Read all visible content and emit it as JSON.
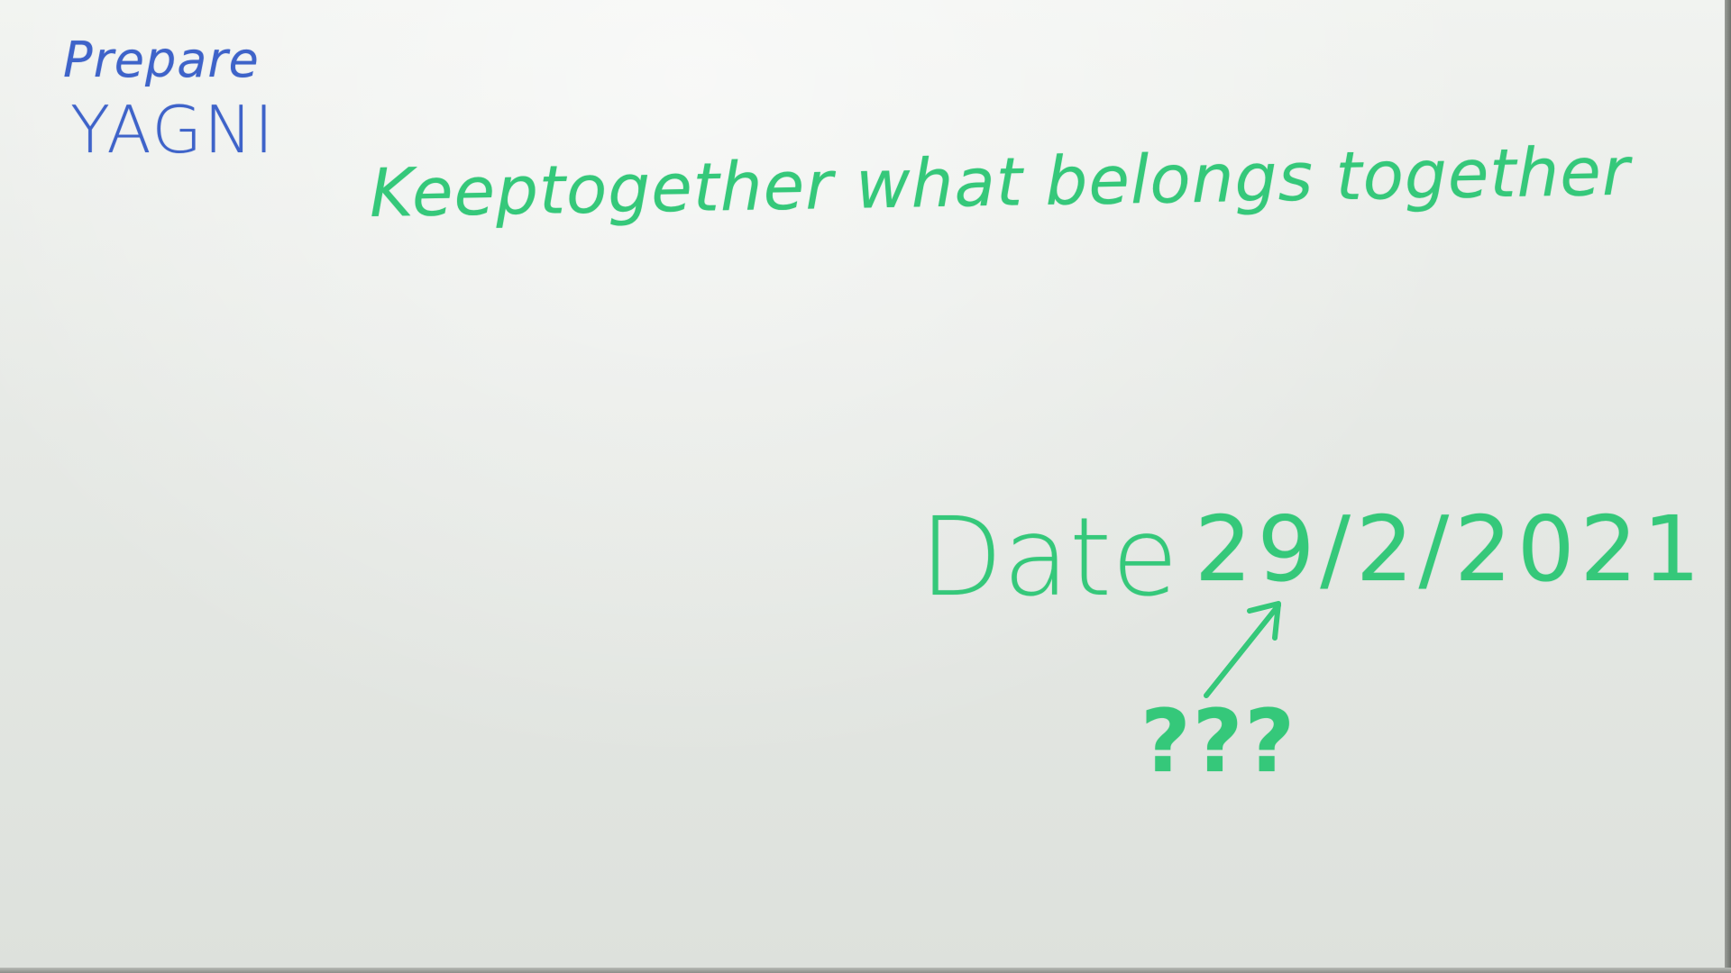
{
  "whiteboard": {
    "note_top_left": {
      "line1": "Prepare",
      "line2": "YAGNI",
      "ink_color": "#3e63c9"
    },
    "headline": "Keeptogether what belongs together",
    "date_label": "Date",
    "date_value": "29/2/2021",
    "questions": "???",
    "ink_color": "#35c87a",
    "arrow_icon": "arrow-up-right-icon"
  }
}
